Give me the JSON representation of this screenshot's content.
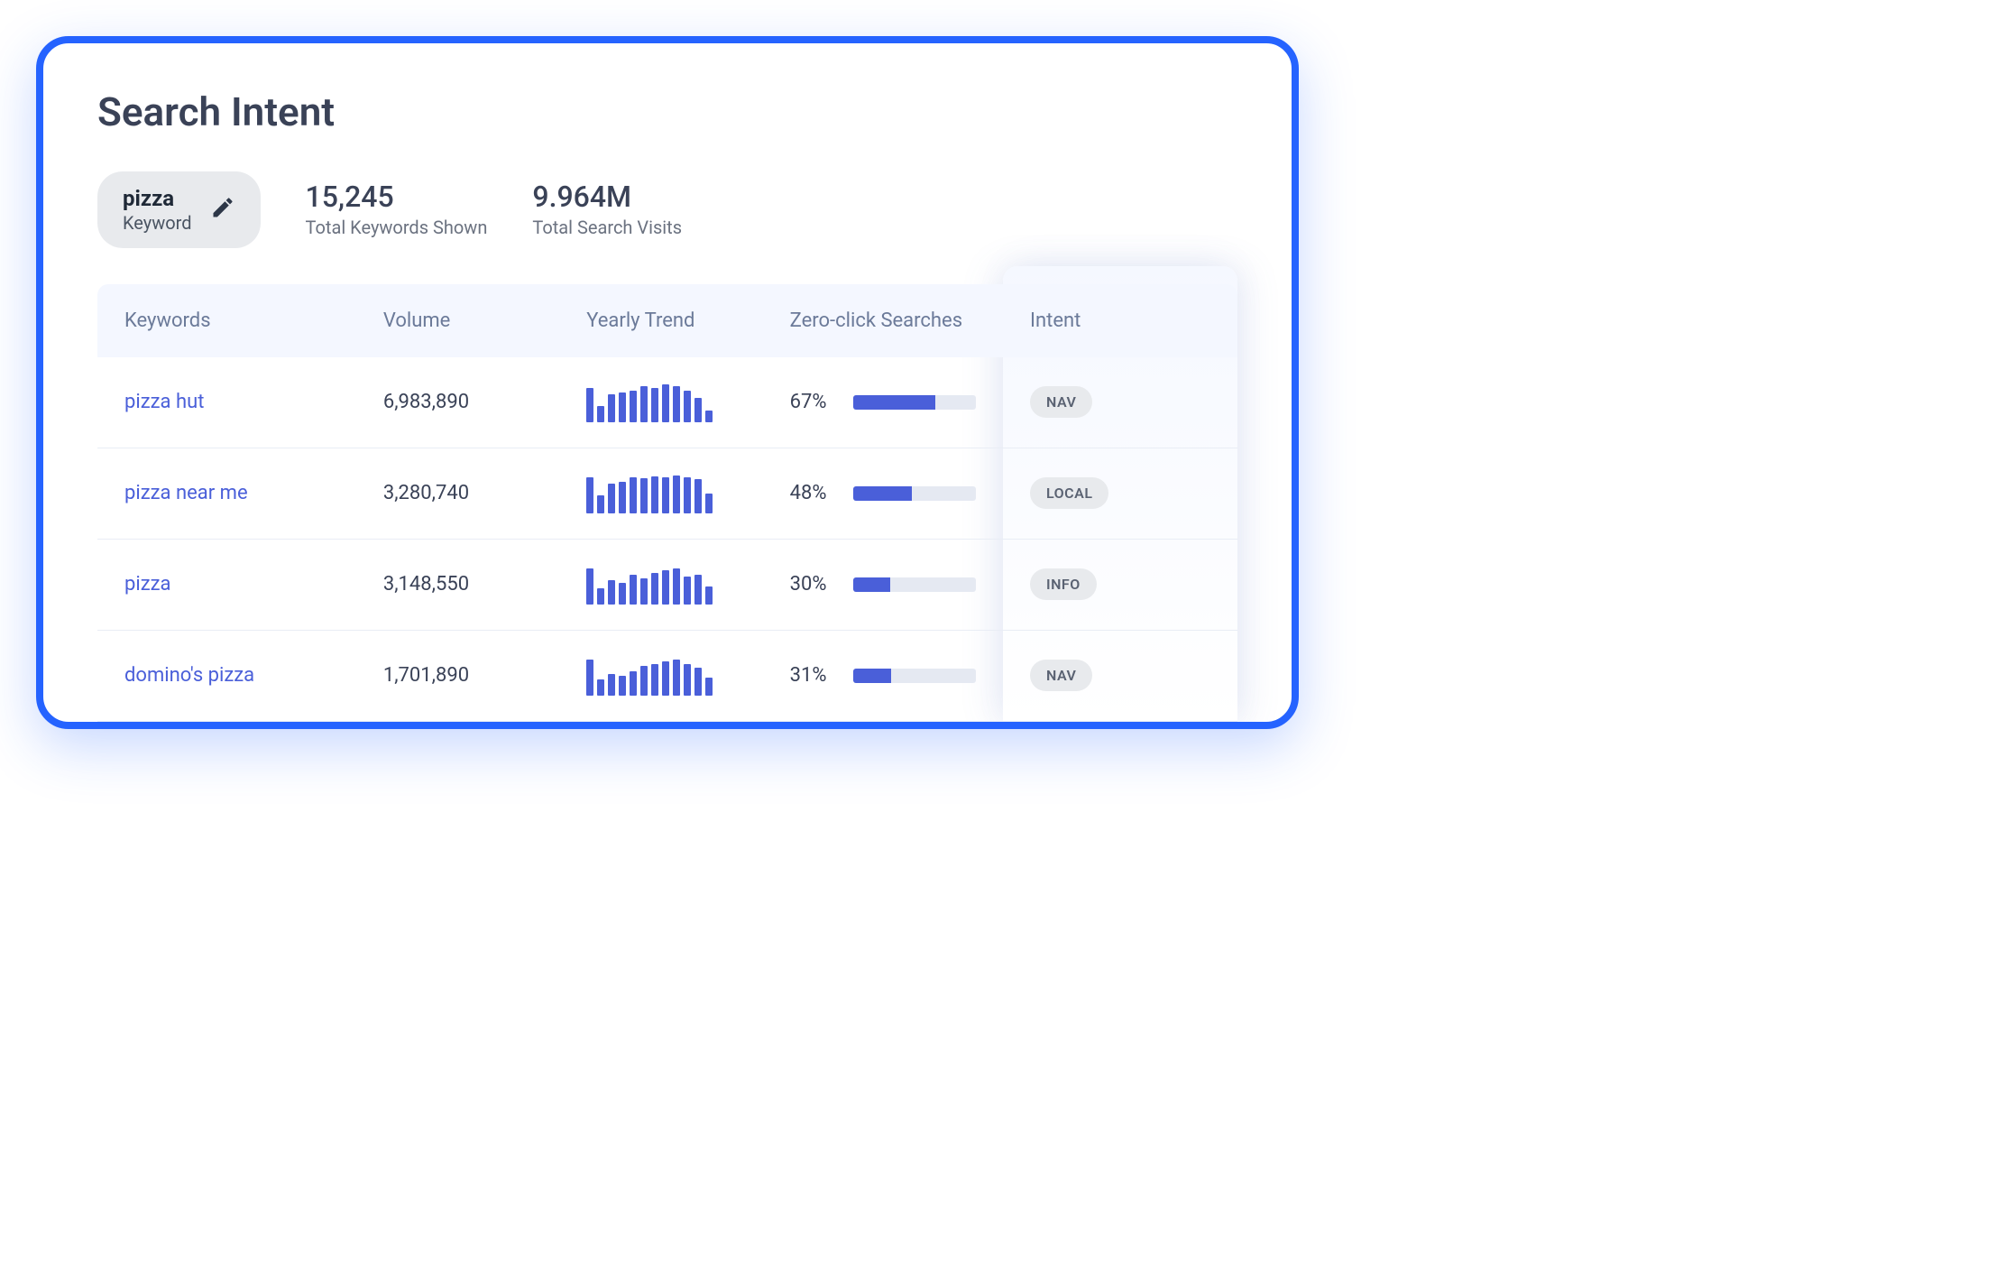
{
  "title": "Search Intent",
  "keyword": {
    "value": "pizza",
    "label": "Keyword"
  },
  "stats": {
    "total_keywords": {
      "value": "15,245",
      "label": "Total Keywords Shown"
    },
    "total_visits": {
      "value": "9.964M",
      "label": "Total Search Visits"
    }
  },
  "columns": {
    "keywords": "Keywords",
    "volume": "Volume",
    "trend": "Yearly Trend",
    "zeroclick": "Zero-click Searches",
    "intent": "Intent"
  },
  "rows": [
    {
      "keyword": "pizza hut",
      "volume": "6,983,890",
      "trend": [
        85,
        40,
        70,
        75,
        80,
        90,
        85,
        95,
        90,
        80,
        60,
        30
      ],
      "zero_click_pct": "67%",
      "zero_click_fill": 67,
      "intent": "NAV"
    },
    {
      "keyword": "pizza near me",
      "volume": "3,280,740",
      "trend": [
        90,
        45,
        75,
        80,
        90,
        88,
        92,
        90,
        95,
        90,
        85,
        50
      ],
      "zero_click_pct": "48%",
      "zero_click_fill": 48,
      "intent": "LOCAL"
    },
    {
      "keyword": "pizza",
      "volume": "3,148,550",
      "trend": [
        90,
        40,
        60,
        55,
        75,
        65,
        80,
        85,
        90,
        70,
        75,
        45
      ],
      "zero_click_pct": "30%",
      "zero_click_fill": 30,
      "intent": "INFO"
    },
    {
      "keyword": "domino's pizza",
      "volume": "1,701,890",
      "trend": [
        90,
        40,
        55,
        50,
        60,
        75,
        80,
        85,
        90,
        80,
        70,
        45
      ],
      "zero_click_pct": "31%",
      "zero_click_fill": 31,
      "intent": "NAV"
    }
  ],
  "chart_data": {
    "type": "bar",
    "title": "Yearly Trend sparklines per keyword (relative heights, 12 periods)",
    "series": [
      {
        "name": "pizza hut",
        "values": [
          85,
          40,
          70,
          75,
          80,
          90,
          85,
          95,
          90,
          80,
          60,
          30
        ]
      },
      {
        "name": "pizza near me",
        "values": [
          90,
          45,
          75,
          80,
          90,
          88,
          92,
          90,
          95,
          90,
          85,
          50
        ]
      },
      {
        "name": "pizza",
        "values": [
          90,
          40,
          60,
          55,
          75,
          65,
          80,
          85,
          90,
          70,
          75,
          45
        ]
      },
      {
        "name": "domino's pizza",
        "values": [
          90,
          40,
          55,
          50,
          60,
          75,
          80,
          85,
          90,
          80,
          70,
          45
        ]
      }
    ]
  }
}
